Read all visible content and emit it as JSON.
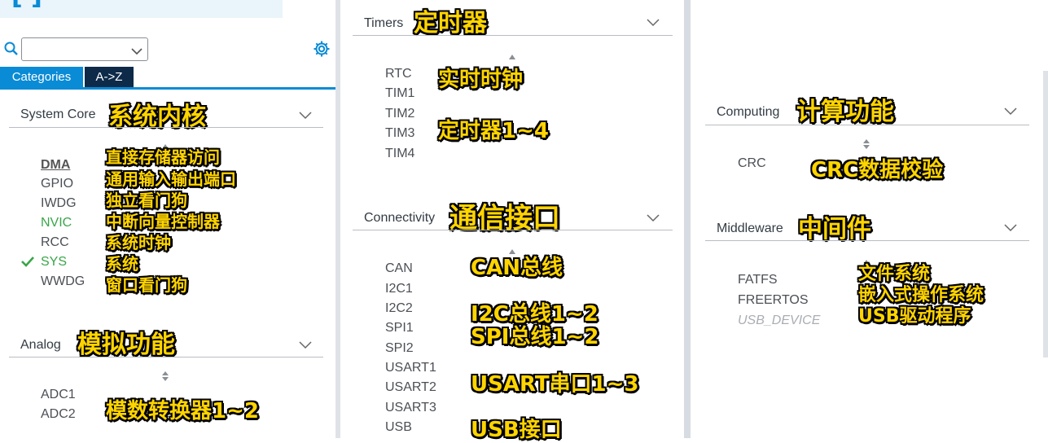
{
  "colors": {
    "accent": "#0a8bd6",
    "enabled_green": "#3aa54a",
    "annotation": "#ffd400",
    "dark_tab": "#0d2a49"
  },
  "left_panel": {
    "top_partial_text": "[    ]",
    "search": {
      "icon": "search-icon",
      "value": "",
      "dropdown_icon": "chevron-down-icon"
    },
    "settings_icon": "gear-icon",
    "tabs": [
      {
        "label": "Categories"
      },
      {
        "label": "A->Z"
      }
    ],
    "system_core": {
      "title": "System Core",
      "annotation": "系统内核",
      "items": [
        {
          "label": "DMA",
          "annotation": "直接存储器访问"
        },
        {
          "label": "GPIO",
          "annotation": "通用输入输出端口"
        },
        {
          "label": "IWDG",
          "annotation": "独立看门狗"
        },
        {
          "label": "NVIC",
          "annotation": "中断向量控制器"
        },
        {
          "label": "RCC",
          "annotation": "系统时钟"
        },
        {
          "label": "SYS",
          "annotation": "系统"
        },
        {
          "label": "WWDG",
          "annotation": "窗口看门狗"
        }
      ]
    },
    "analog": {
      "title": "Analog",
      "annotation": "模拟功能",
      "items": [
        {
          "label": "ADC1"
        },
        {
          "label": "ADC2"
        }
      ],
      "items_annotation": "模数转换器1~2"
    }
  },
  "middle_panel": {
    "timers": {
      "title": "Timers",
      "annotation": "定时器",
      "items": [
        {
          "label": "RTC"
        },
        {
          "label": "TIM1"
        },
        {
          "label": "TIM2"
        },
        {
          "label": "TIM3"
        },
        {
          "label": "TIM4"
        }
      ],
      "rtc_annotation": "实时时钟",
      "tim_annotation": "定时器1~4"
    },
    "connectivity": {
      "title": "Connectivity",
      "annotation": "通信接口",
      "items": [
        {
          "label": "CAN"
        },
        {
          "label": "I2C1"
        },
        {
          "label": "I2C2"
        },
        {
          "label": "SPI1"
        },
        {
          "label": "SPI2"
        },
        {
          "label": "USART1"
        },
        {
          "label": "USART2"
        },
        {
          "label": "USART3"
        },
        {
          "label": "USB"
        }
      ],
      "can_annotation": "CAN总线",
      "i2c_annotation": "I2C总线1~2",
      "spi_annotation": "SPI总线1~2",
      "usart_annotation": "USART串口1~3",
      "usb_annotation": "USB接口"
    }
  },
  "right_panel": {
    "computing": {
      "title": "Computing",
      "annotation": "计算功能",
      "items": [
        {
          "label": "CRC"
        }
      ],
      "crc_annotation": "CRC数据校验"
    },
    "middleware": {
      "title": "Middleware",
      "annotation": "中间件",
      "items": [
        {
          "label": "FATFS"
        },
        {
          "label": "FREERTOS"
        },
        {
          "label": "USB_DEVICE"
        }
      ],
      "fatfs_annotation": "文件系统",
      "freertos_annotation": "嵌入式操作系统",
      "usb_annotation": "USB驱动程序"
    }
  }
}
